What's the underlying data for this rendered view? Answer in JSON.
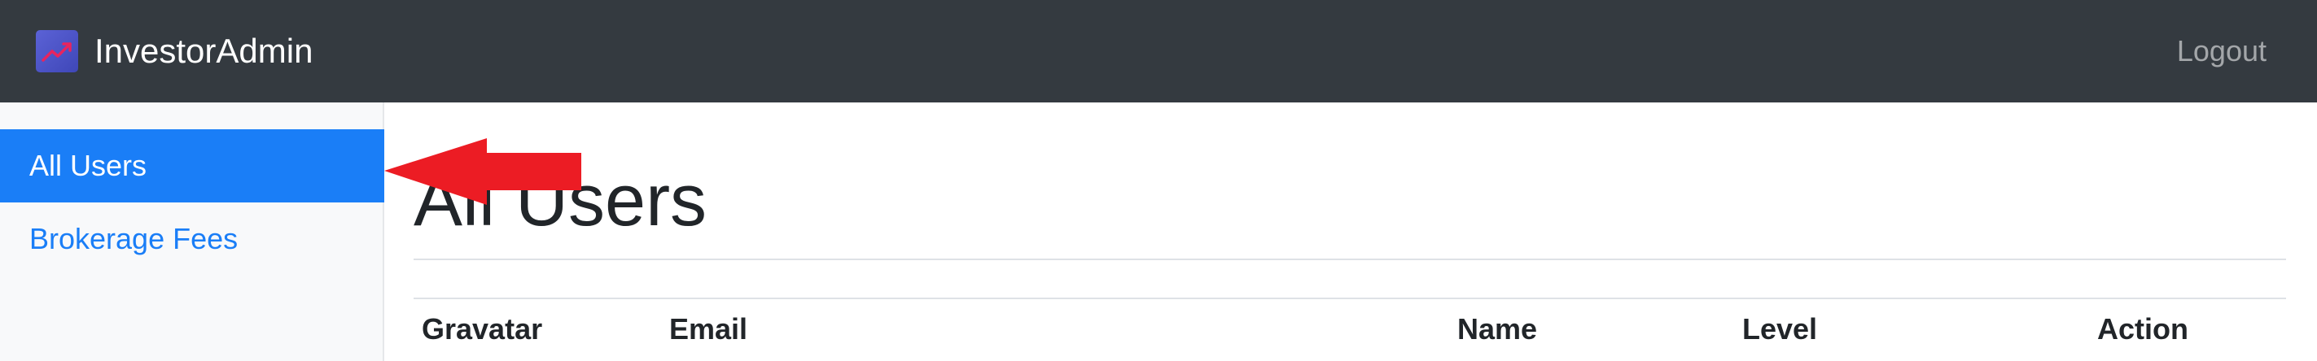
{
  "header": {
    "brand": "InvestorAdmin",
    "logo_icon": "trending-up-icon",
    "logout_label": "Logout"
  },
  "sidebar": {
    "items": [
      {
        "label": "All Users",
        "active": true
      },
      {
        "label": "Brokerage Fees",
        "active": false
      }
    ]
  },
  "main": {
    "title": "All Users",
    "table": {
      "columns": [
        "Gravatar",
        "Email",
        "Name",
        "Level",
        "Action"
      ]
    }
  },
  "annotation": {
    "icon": "red-arrow-pointer"
  },
  "colors": {
    "topbar": "#343a40",
    "accent": "#1a7ef7",
    "sidebar_bg": "#f8f9fa",
    "arrow": "#ec1c24"
  }
}
